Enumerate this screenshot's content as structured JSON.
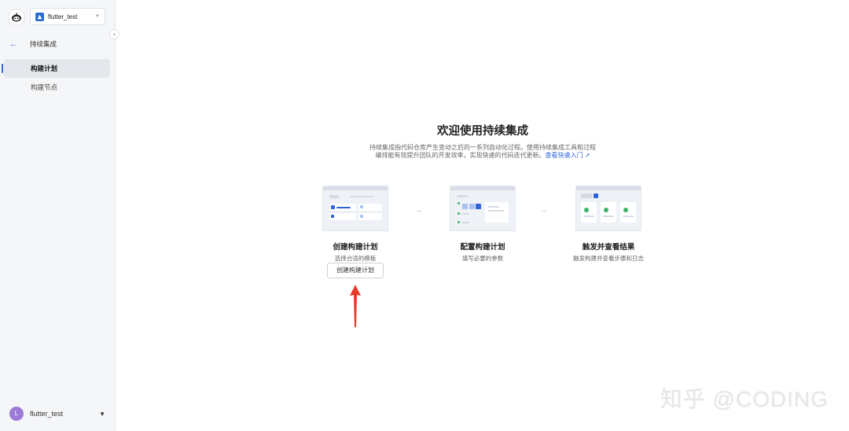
{
  "sidebar": {
    "project_name": "flutter_test",
    "back_label": "持续集成",
    "items": [
      {
        "label": "构建计划",
        "active": true
      },
      {
        "label": "构建节点",
        "active": false
      }
    ],
    "user": {
      "initial": "L",
      "name": "flutter_test"
    }
  },
  "main": {
    "title": "欢迎使用持续集成",
    "desc_line1": "持续集成指代码仓库产生变动之后的一系列自动化过程。使用持续集成工具和过程",
    "desc_line2": "编排能有效提升团队的开发效率，实现快速的代码迭代更新。",
    "quickstart_link": "查看快速入门",
    "steps": [
      {
        "title": "创建构建计划",
        "subtitle": "选择合适的模板"
      },
      {
        "title": "配置构建计划",
        "subtitle": "填写必要的参数"
      },
      {
        "title": "触发并查看结果",
        "subtitle": "触发构建并查看步骤和日志"
      }
    ],
    "create_button": "创建构建计划"
  },
  "watermark": "知乎 @CODING",
  "colors": {
    "accent": "#2f64d8",
    "annotation_arrow": "#e8392b",
    "success": "#3bb36b"
  }
}
